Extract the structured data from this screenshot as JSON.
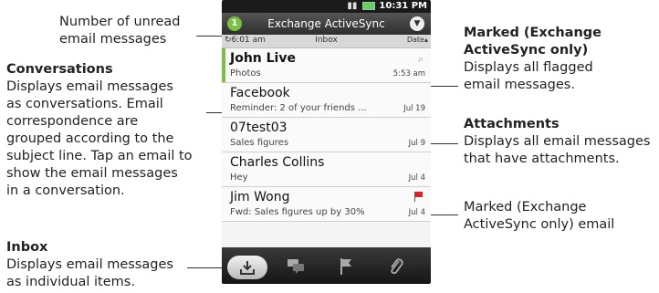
{
  "status_bar": {
    "time": "10:31 PM"
  },
  "header": {
    "unread_count": "1",
    "account": "Exchange ActiveSync"
  },
  "subheader": {
    "sync_time": "6:01 am",
    "folder": "Inbox",
    "sort": "Date"
  },
  "emails": [
    {
      "sender": "John Live",
      "preview": "Photos",
      "date": "5:53 am",
      "unread": true,
      "attachment": true
    },
    {
      "sender": "Facebook",
      "preview": "Reminder: 2 of your friends ...",
      "date": "Jul 19"
    },
    {
      "sender": "07test03",
      "preview": "Sales figures",
      "date": "Jul 9"
    },
    {
      "sender": "Charles Collins",
      "preview": "Hey",
      "date": "Jul 4"
    },
    {
      "sender": "Jim Wong",
      "preview": "Fwd: Sales figures up by 30%",
      "date": "Jul 4",
      "flagged": true
    }
  ],
  "tabs": [
    "inbox-tab",
    "conversations-tab",
    "marked-tab",
    "attachments-tab"
  ],
  "colors": {
    "unread_accent": "#7bc043",
    "flag": "#dd2222",
    "pointer": "#2266cc"
  },
  "annotations": {
    "unread": {
      "line1": "Number of unread",
      "line2": "email messages"
    },
    "conversations": {
      "title": "Conversations",
      "l1": "Displays email messages",
      "l2": "as conversations. Email",
      "l3": "correspondence are",
      "l4": "grouped according to the",
      "l5": "subject line. Tap an email to",
      "l6": "show the email messages",
      "l7": "in a conversation."
    },
    "inbox": {
      "title": "Inbox",
      "l1": "Displays email messages",
      "l2": "as individual items."
    },
    "marked": {
      "title1": "Marked (Exchange",
      "title2": "ActiveSync only)",
      "l1": "Displays all flagged",
      "l2": "email messages."
    },
    "attachments": {
      "title": "Attachments",
      "l1": "Displays all email messages",
      "l2": "that have attachments."
    },
    "marked_email": {
      "l1": "Marked (Exchange",
      "l2": "ActiveSync only) email"
    }
  }
}
